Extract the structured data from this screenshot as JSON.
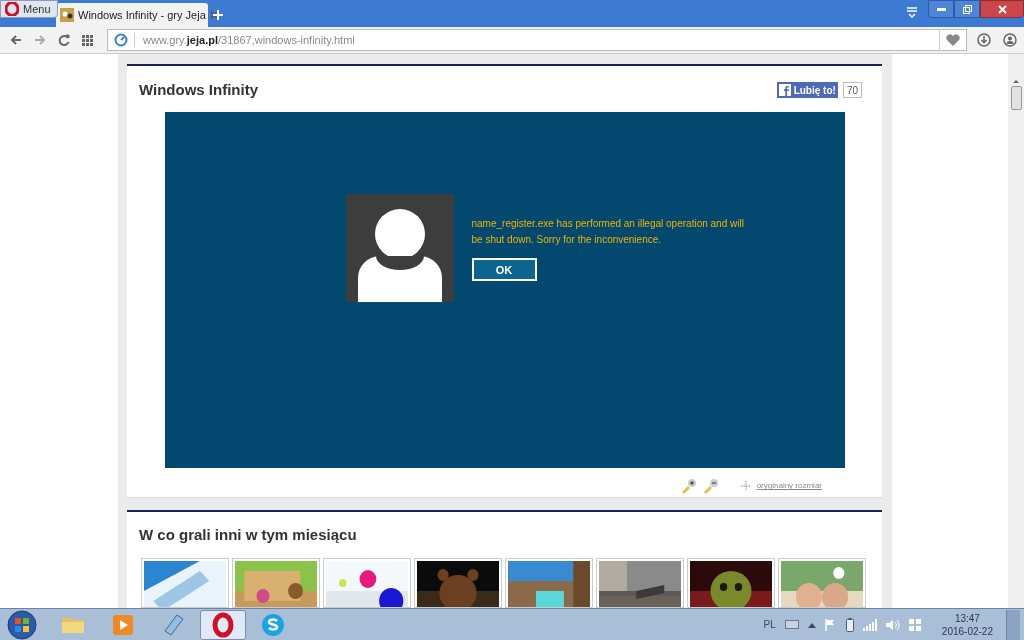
{
  "browser": {
    "menu_label": "Menu",
    "tabs": [
      {
        "title": "Windows Infinity - gry Jeja",
        "selected": true
      }
    ],
    "url": "www.gry.**jeja.pl**/31867,windows-infinity.html"
  },
  "game": {
    "title": "Windows Infinity",
    "like_label": "Lubię to!",
    "like_count": "70",
    "dialog": {
      "message": "name_register.exe has performed an illegal operation and will be shut down. Sorry for the inconvenience.",
      "button": "OK"
    },
    "size_link": "oryginalny rozmiar"
  },
  "related": {
    "title": "W co grali inni w tym miesiącu"
  },
  "taskbar": {
    "apps": [
      {
        "kind": "folder",
        "selected": false
      },
      {
        "kind": "media",
        "selected": false
      },
      {
        "kind": "notes",
        "selected": false
      },
      {
        "kind": "opera",
        "selected": true
      },
      {
        "kind": "skype",
        "selected": false
      }
    ],
    "language": "PL",
    "time": "13:47",
    "date": "2016-02-22"
  }
}
